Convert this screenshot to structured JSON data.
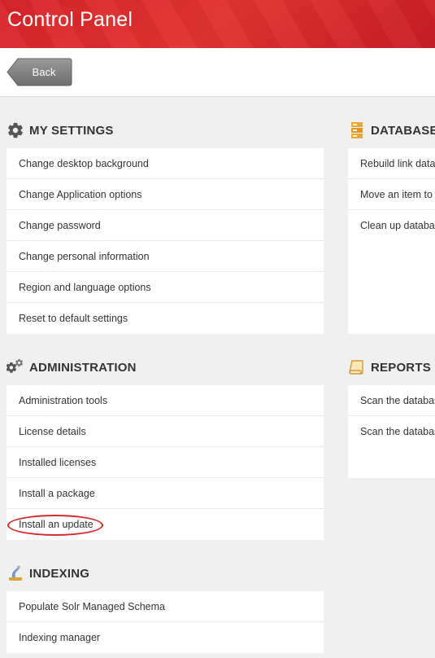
{
  "header": {
    "title": "Control Panel"
  },
  "toolbar": {
    "back_label": "Back"
  },
  "sections": {
    "my_settings": {
      "title": "MY SETTINGS",
      "icon": "gear-icon",
      "items": [
        "Change desktop background",
        "Change Application options",
        "Change password",
        "Change personal information",
        "Region and language options",
        "Reset to default settings"
      ]
    },
    "database": {
      "title": "DATABASE",
      "icon": "database-icon",
      "items": [
        "Rebuild link data",
        "Move an item to",
        "Clean up databa"
      ]
    },
    "administration": {
      "title": "ADMINISTRATION",
      "icon": "gears-icon",
      "items": [
        "Administration tools",
        "License details",
        "Installed licenses",
        "Install a package",
        "Install an update"
      ]
    },
    "reports": {
      "title": "REPORTS",
      "icon": "scroll-icon",
      "items": [
        "Scan the databas",
        "Scan the databas"
      ]
    },
    "indexing": {
      "title": "INDEXING",
      "icon": "indexing-icon",
      "items": [
        "Populate Solr Managed Schema",
        "Indexing manager"
      ]
    }
  },
  "colors": {
    "header": "#d8242a",
    "back_button": "#808080",
    "highlight": "#d42a2a"
  }
}
